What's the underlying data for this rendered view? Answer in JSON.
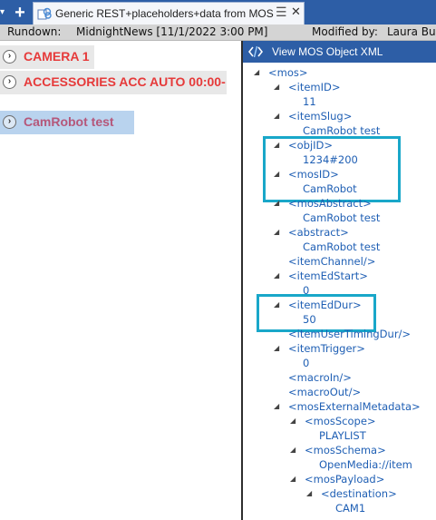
{
  "tab": {
    "title": "Generic REST+placeholders+data from MOS",
    "drag_glyph": "☰",
    "close_glyph": "✕",
    "add_glyph": "+",
    "menu_glyph": "▾",
    "icon": "link-document-icon"
  },
  "rundown": {
    "label": "Rundown:",
    "value": "MidnightNews [11/1/2022 3:00 PM]",
    "modified_label": "Modified by:",
    "modified_value": "Laura Burr"
  },
  "items": [
    {
      "label": "CAMERA 1",
      "color": "#e63a3a"
    },
    {
      "label": "ACCESSORIES ACC AUTO 00:00-",
      "color": "#e63a3a"
    },
    {
      "label": "CamRobot test",
      "color": "#b5577a"
    }
  ],
  "expand_glyph": "›",
  "xml_panel": {
    "title": "View MOS Object XML",
    "icon": "xml-brackets-icon",
    "nodes": [
      {
        "text": "<mos>",
        "type": "tag"
      },
      {
        "text": "<itemID>",
        "type": "tag"
      },
      {
        "text": "11",
        "type": "val"
      },
      {
        "text": "<itemSlug>",
        "type": "tag"
      },
      {
        "text": "CamRobot test",
        "type": "val"
      },
      {
        "text": "<objID>",
        "type": "tag"
      },
      {
        "text": "1234#200",
        "type": "val"
      },
      {
        "text": "<mosID>",
        "type": "tag"
      },
      {
        "text": "CamRobot",
        "type": "val"
      },
      {
        "text": "<mosAbstract>",
        "type": "tag"
      },
      {
        "text": "CamRobot test",
        "type": "val"
      },
      {
        "text": "<abstract>",
        "type": "tag"
      },
      {
        "text": "CamRobot test",
        "type": "val"
      },
      {
        "text": "<itemChannel/>",
        "type": "tag"
      },
      {
        "text": "<itemEdStart>",
        "type": "tag"
      },
      {
        "text": "0",
        "type": "val"
      },
      {
        "text": "<itemEdDur>",
        "type": "tag"
      },
      {
        "text": "50",
        "type": "val"
      },
      {
        "text": "<itemUserTimingDur/>",
        "type": "tag"
      },
      {
        "text": "<itemTrigger>",
        "type": "tag"
      },
      {
        "text": "0",
        "type": "val"
      },
      {
        "text": "<macroIn/>",
        "type": "tag"
      },
      {
        "text": "<macroOut/>",
        "type": "tag"
      },
      {
        "text": "<mosExternalMetadata>",
        "type": "tag"
      },
      {
        "text": "<mosScope>",
        "type": "tag"
      },
      {
        "text": "PLAYLIST",
        "type": "val"
      },
      {
        "text": "<mosSchema>",
        "type": "tag"
      },
      {
        "text": "OpenMedia://item",
        "type": "val"
      },
      {
        "text": "<mosPayload>",
        "type": "tag"
      },
      {
        "text": "<destination>",
        "type": "tag"
      },
      {
        "text": "CAM1",
        "type": "val"
      }
    ]
  },
  "collapse_glyph": "◢",
  "colors": {
    "accent": "#2d5ea6",
    "highlight": "#19a7c9",
    "xml_text": "#1f5fb4",
    "item_red": "#e63a3a",
    "item_selected_bg": "#b9d3ee"
  }
}
